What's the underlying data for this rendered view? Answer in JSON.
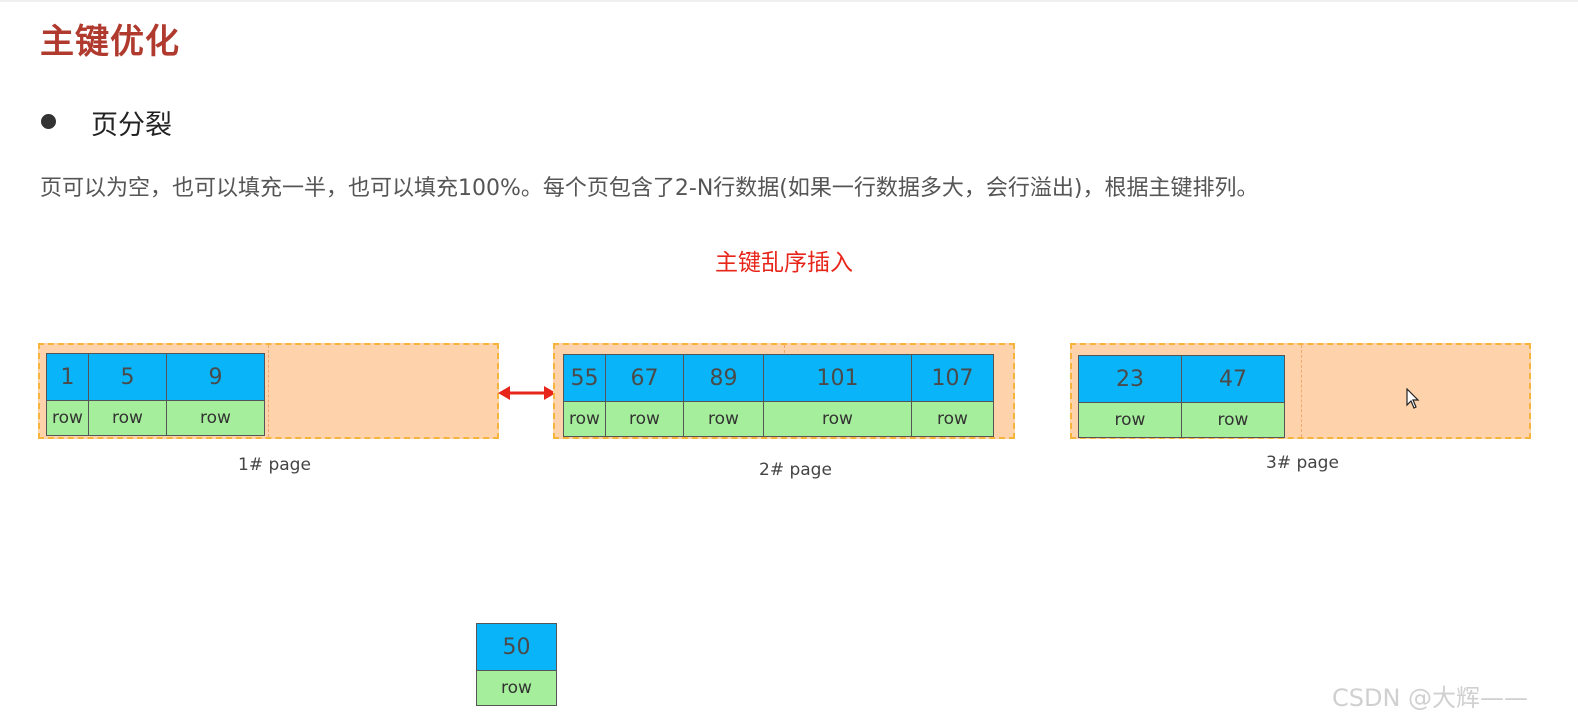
{
  "heading": {
    "title": "主键优化"
  },
  "bullet": {
    "text": "页分裂"
  },
  "description": "页可以为空，也可以填充一半，也可以填充100%。每个页包含了2-N行数据(如果一行数据多大，会行溢出)，根据主键排列。",
  "diagram": {
    "title": "主键乱序插入",
    "pages": [
      {
        "label": "1#  page",
        "keys": [
          "1",
          "5",
          "9"
        ],
        "row_label": "row"
      },
      {
        "label": "2#  page",
        "keys": [
          "55",
          "67",
          "89",
          "101",
          "107"
        ],
        "row_label": "row"
      },
      {
        "label": "3#  page",
        "keys": [
          "23",
          "47"
        ],
        "row_label": "row"
      }
    ],
    "new_record": {
      "key": "50",
      "row_label": "row"
    }
  },
  "colors": {
    "title": "#b03a2e",
    "subtitle": "#e8251a",
    "key_fill": "#0ab4f8",
    "row_fill": "#a5ee9b",
    "page_fill": "#fed3ac",
    "page_border": "#f7b43a",
    "arrow": "#e8251a"
  },
  "watermark": "CSDN @大辉——"
}
